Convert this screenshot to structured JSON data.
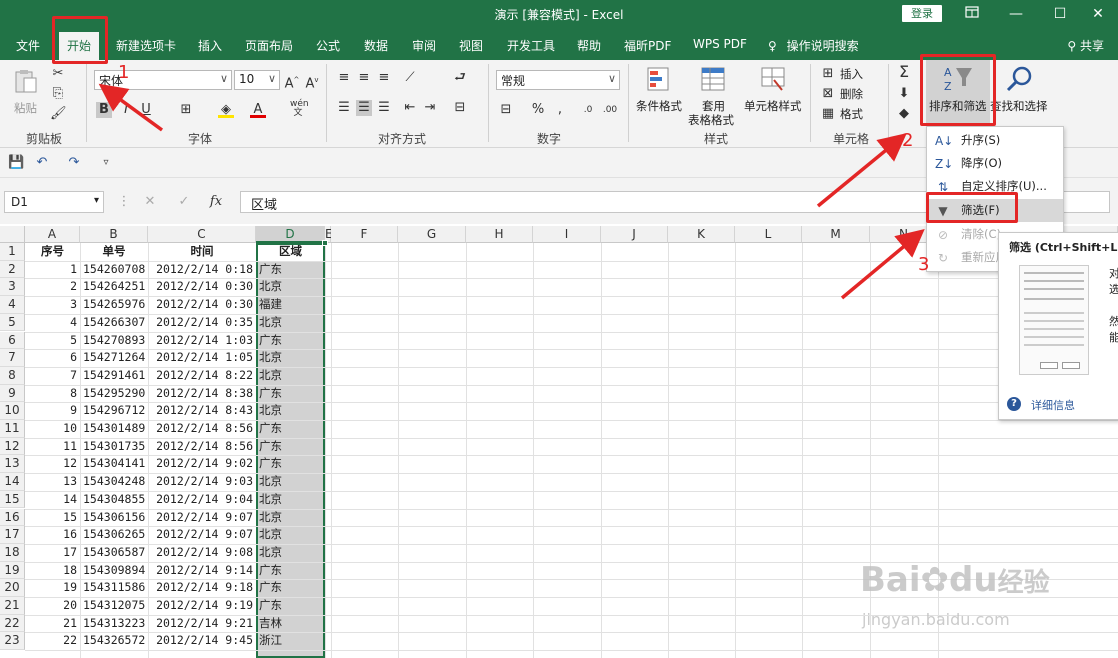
{
  "title": "演示 [兼容模式] - Excel",
  "login": "登录",
  "share": "共享",
  "tabs": [
    "文件",
    "开始",
    "新建选项卡",
    "插入",
    "页面布局",
    "公式",
    "数据",
    "审阅",
    "视图",
    "开发工具",
    "帮助",
    "福昕PDF",
    "WPS PDF",
    "操作说明搜索"
  ],
  "ribbon": {
    "clipboard": {
      "paste": "粘贴",
      "label": "剪贴板"
    },
    "font": {
      "name": "宋体",
      "size": "10",
      "bold": "B",
      "italic": "I",
      "underline": "U",
      "label": "字体",
      "wen": "wén\n文"
    },
    "alignment": {
      "label": "对齐方式"
    },
    "number": {
      "format": "常规",
      "label": "数字",
      "percent": "%",
      "comma": ","
    },
    "styles": {
      "conditional": "条件格式",
      "table1": "套用",
      "table2": "表格格式",
      "cell_styles": "单元格样式",
      "label": "样式"
    },
    "cells": {
      "insert": "插入",
      "delete": "删除",
      "format": "格式",
      "label": "单元格"
    },
    "editing": {
      "sort_filter": "排序和筛选",
      "find_select": "查找和选择"
    }
  },
  "formula_bar": {
    "cell_ref": "D1",
    "fx": "fx",
    "content": "区域"
  },
  "columns": [
    "A",
    "B",
    "C",
    "D",
    "E",
    "F",
    "G",
    "H",
    "I",
    "J",
    "K",
    "L",
    "M",
    "N"
  ],
  "headers": {
    "a": "序号",
    "b": "单号",
    "c": "时间",
    "d": "区域"
  },
  "rows": [
    {
      "n": "1",
      "a": "",
      "b": "",
      "c": "",
      "d": ""
    },
    {
      "n": "2",
      "a": "1",
      "b": "154260708",
      "c": "2012/2/14 0:18",
      "d": "广东"
    },
    {
      "n": "3",
      "a": "2",
      "b": "154264251",
      "c": "2012/2/14 0:30",
      "d": "北京"
    },
    {
      "n": "4",
      "a": "3",
      "b": "154265976",
      "c": "2012/2/14 0:30",
      "d": "福建"
    },
    {
      "n": "5",
      "a": "4",
      "b": "154266307",
      "c": "2012/2/14 0:35",
      "d": "北京"
    },
    {
      "n": "6",
      "a": "5",
      "b": "154270893",
      "c": "2012/2/14 1:03",
      "d": "广东"
    },
    {
      "n": "7",
      "a": "6",
      "b": "154271264",
      "c": "2012/2/14 1:05",
      "d": "北京"
    },
    {
      "n": "8",
      "a": "7",
      "b": "154291461",
      "c": "2012/2/14 8:22",
      "d": "北京"
    },
    {
      "n": "9",
      "a": "8",
      "b": "154295290",
      "c": "2012/2/14 8:38",
      "d": "广东"
    },
    {
      "n": "10",
      "a": "9",
      "b": "154296712",
      "c": "2012/2/14 8:43",
      "d": "北京"
    },
    {
      "n": "11",
      "a": "10",
      "b": "154301489",
      "c": "2012/2/14 8:56",
      "d": "广东"
    },
    {
      "n": "12",
      "a": "11",
      "b": "154301735",
      "c": "2012/2/14 8:56",
      "d": "广东"
    },
    {
      "n": "13",
      "a": "12",
      "b": "154304141",
      "c": "2012/2/14 9:02",
      "d": "广东"
    },
    {
      "n": "14",
      "a": "13",
      "b": "154304248",
      "c": "2012/2/14 9:03",
      "d": "北京"
    },
    {
      "n": "15",
      "a": "14",
      "b": "154304855",
      "c": "2012/2/14 9:04",
      "d": "北京"
    },
    {
      "n": "16",
      "a": "15",
      "b": "154306156",
      "c": "2012/2/14 9:07",
      "d": "北京"
    },
    {
      "n": "17",
      "a": "16",
      "b": "154306265",
      "c": "2012/2/14 9:07",
      "d": "北京"
    },
    {
      "n": "18",
      "a": "17",
      "b": "154306587",
      "c": "2012/2/14 9:08",
      "d": "北京"
    },
    {
      "n": "19",
      "a": "18",
      "b": "154309894",
      "c": "2012/2/14 9:14",
      "d": "广东"
    },
    {
      "n": "20",
      "a": "19",
      "b": "154311586",
      "c": "2012/2/14 9:18",
      "d": "广东"
    },
    {
      "n": "21",
      "a": "20",
      "b": "154312075",
      "c": "2012/2/14 9:19",
      "d": "广东"
    },
    {
      "n": "22",
      "a": "21",
      "b": "154313223",
      "c": "2012/2/14 9:21",
      "d": "吉林"
    },
    {
      "n": "23",
      "a": "22",
      "b": "154326572",
      "c": "2012/2/14 9:45",
      "d": "浙江"
    }
  ],
  "sort_menu": {
    "items": [
      {
        "label": "升序(S)",
        "icon": "sort-ascending-icon",
        "disabled": false
      },
      {
        "label": "降序(O)",
        "icon": "sort-descending-icon",
        "disabled": false
      },
      {
        "label": "自定义排序(U)...",
        "icon": "custom-sort-icon",
        "disabled": false
      },
      {
        "label": "筛选(F)",
        "icon": "filter-icon",
        "disabled": false,
        "highlighted": true
      },
      {
        "label": "清除(C)",
        "icon": "clear-filter-icon",
        "disabled": true
      },
      {
        "label": "重新应用",
        "icon": "reapply-icon",
        "disabled": true
      }
    ]
  },
  "tooltip": {
    "title": "筛选 (Ctrl+Shift+L)",
    "line1": "对",
    "line2": "选",
    "line3": "然",
    "line4": "能",
    "more": "详细信息"
  },
  "annotations": [
    "1",
    "2",
    "3"
  ],
  "watermark": {
    "brand": "Bai",
    "brand2": "du",
    "brand3": "经验",
    "url": "jingyan.baidu.com"
  },
  "colors": {
    "excel_green": "#217346",
    "annotation_red": "#e32626",
    "selected_col": "#d2d2d2"
  }
}
